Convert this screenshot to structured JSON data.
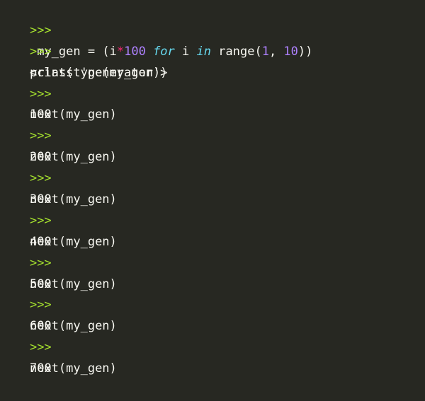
{
  "prompt": ">>>",
  "line1": {
    "name": "my_gen",
    "assign": " = ",
    "open_paren": "(",
    "var": "i",
    "op": "*",
    "multiplier": "100",
    "for_kw": "for",
    "loop_var": "i",
    "in_kw": "in",
    "range_fn": "range(",
    "start": "1",
    "comma": ", ",
    "stop": "10",
    "close": "))"
  },
  "line2": {
    "code": "print(type(my_gen))"
  },
  "line3": {
    "output": "<class 'generator'>"
  },
  "repl": [
    {
      "code": "next(my_gen)",
      "output": "100"
    },
    {
      "code": "next(my_gen)",
      "output": "200"
    },
    {
      "code": "next(my_gen)",
      "output": "300"
    },
    {
      "code": "next(my_gen)",
      "output": "400"
    },
    {
      "code": "next(my_gen)",
      "output": "500"
    },
    {
      "code": "next(my_gen)",
      "output": "600"
    },
    {
      "code": "next(my_gen)",
      "output": "700"
    }
  ],
  "colors": {
    "background": "#272822",
    "prompt": "#a6e22e",
    "keyword": "#66d9ef",
    "number": "#ae81ff",
    "operator": "#f92672",
    "text": "#f8f8f2"
  }
}
